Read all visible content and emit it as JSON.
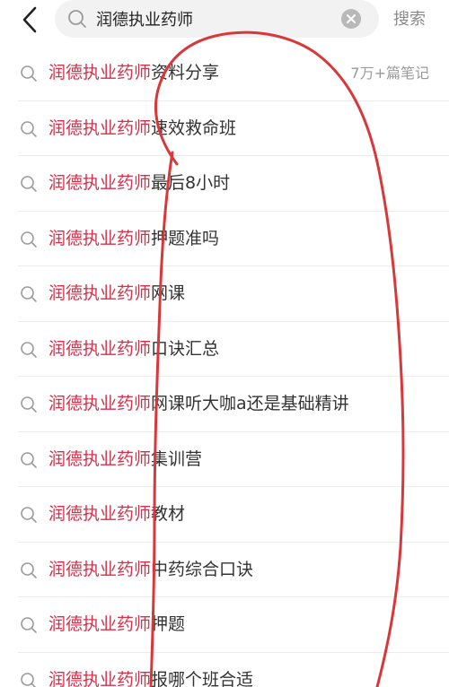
{
  "header": {
    "search_query": "润德执业药师",
    "search_button_label": "搜索"
  },
  "suggestions": [
    {
      "highlight": "润德执业药师",
      "rest": "资料分享",
      "meta": "7万+篇笔记"
    },
    {
      "highlight": "润德执业药师",
      "rest": "速效救命班"
    },
    {
      "highlight": "润德执业药师",
      "rest": "最后8小时"
    },
    {
      "highlight": "润德执业药师",
      "rest": "押题准吗"
    },
    {
      "highlight": "润德执业药师",
      "rest": "网课"
    },
    {
      "highlight": "润德执业药师",
      "rest": "口诀汇总"
    },
    {
      "highlight": "润德执业药师",
      "rest": "网课听大咖a还是基础精讲"
    },
    {
      "highlight": "润德执业药师",
      "rest": "集训营"
    },
    {
      "highlight": "润德执业药师",
      "rest": "教材"
    },
    {
      "highlight": "润德执业药师",
      "rest": "中药综合口诀"
    },
    {
      "highlight": "润德执业药师",
      "rest": "押题"
    },
    {
      "highlight": "润德执业药师",
      "rest": "报哪个班合适"
    }
  ],
  "colors": {
    "highlight": "#d4304a",
    "text": "#333333",
    "muted": "#9a9a9a",
    "search_bg": "#f2f2f2",
    "annotation": "#d9383a"
  },
  "icons": {
    "back": "chevron-left-icon",
    "search": "search-icon",
    "clear": "clear-circle-icon"
  }
}
